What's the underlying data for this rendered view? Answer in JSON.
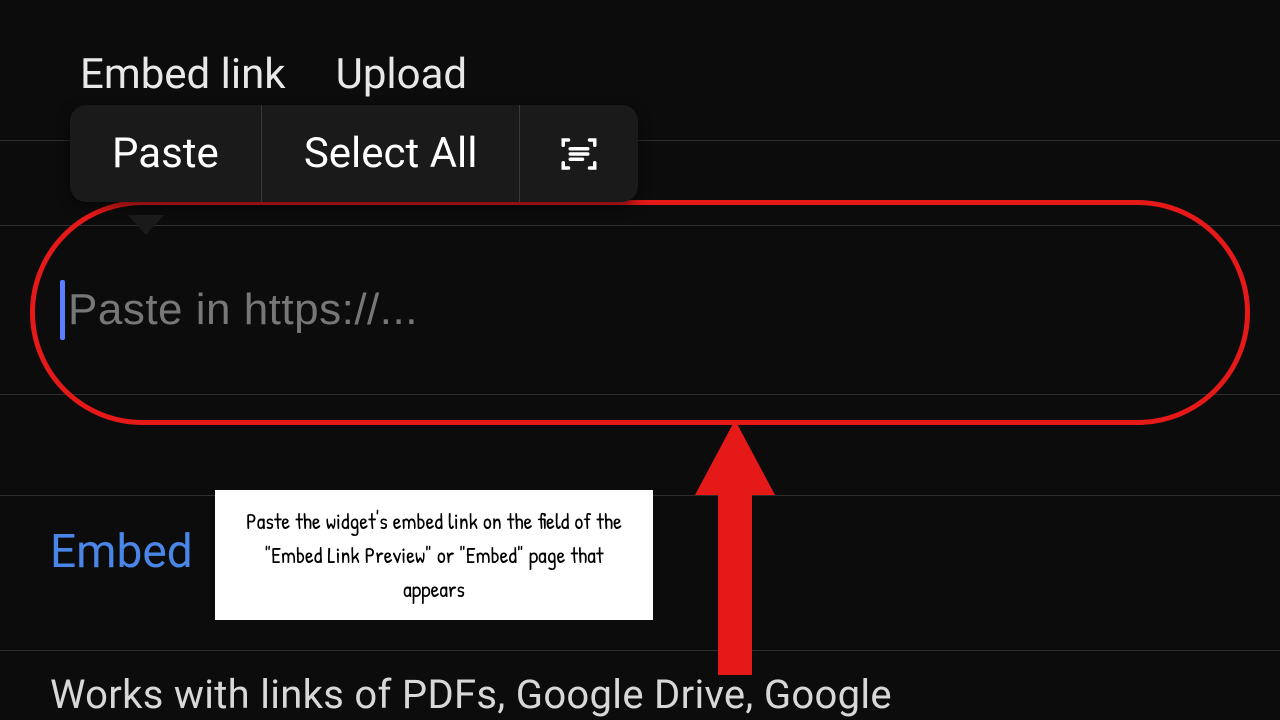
{
  "tabs": {
    "embed_link": "Embed link",
    "upload": "Upload"
  },
  "context_menu": {
    "paste": "Paste",
    "select_all": "Select All",
    "scan_icon": "scan-text"
  },
  "input": {
    "placeholder": "Paste in https://..."
  },
  "embed_link_button": "Embed",
  "annotation": "Paste the widget's embed link on the field of the \"Embed Link Preview\" or \"Embed\" page that appears",
  "footer": "Works with links of PDFs, Google Drive, Google",
  "colors": {
    "highlight": "#e61919",
    "link": "#4a86e8",
    "bg": "#0c0c0c"
  }
}
